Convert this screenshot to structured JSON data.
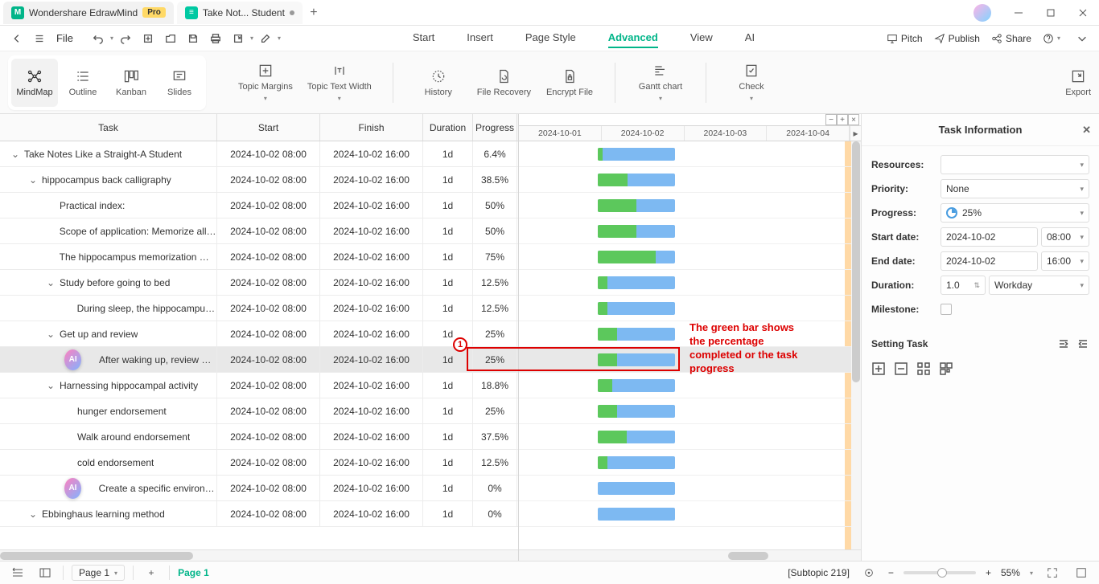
{
  "titlebar": {
    "app_name": "Wondershare EdrawMind",
    "pro_badge": "Pro",
    "doc_tab": "Take Not... Student"
  },
  "quickbar": {
    "file_label": "File"
  },
  "menu": {
    "start": "Start",
    "insert": "Insert",
    "page_style": "Page Style",
    "advanced": "Advanced",
    "view": "View",
    "ai": "AI"
  },
  "right_actions": {
    "pitch": "Pitch",
    "publish": "Publish",
    "share": "Share"
  },
  "view_modes": {
    "mindmap": "MindMap",
    "outline": "Outline",
    "kanban": "Kanban",
    "slides": "Slides"
  },
  "ribbon": {
    "topic_margins": "Topic Margins",
    "topic_text_width": "Topic Text Width",
    "history": "History",
    "file_recovery": "File Recovery",
    "encrypt_file": "Encrypt File",
    "gantt_chart": "Gantt chart",
    "check": "Check",
    "export": "Export"
  },
  "columns": {
    "task": "Task",
    "start": "Start",
    "finish": "Finish",
    "duration": "Duration",
    "progress": "Progress"
  },
  "dates": [
    "2024-10-01",
    "2024-10-02",
    "2024-10-03",
    "2024-10-04"
  ],
  "rows": [
    {
      "indent": 0,
      "exp": true,
      "task": "Take Notes Like a Straight-A Student",
      "start": "2024-10-02 08:00",
      "finish": "2024-10-02 16:00",
      "dur": "1d",
      "prog": "6.4%",
      "pct": 6.4
    },
    {
      "indent": 1,
      "exp": true,
      "task": "hippocampus back calligraphy",
      "start": "2024-10-02 08:00",
      "finish": "2024-10-02 16:00",
      "dur": "1d",
      "prog": "38.5%",
      "pct": 38.5
    },
    {
      "indent": 2,
      "exp": false,
      "task": "Practical index:",
      "start": "2024-10-02 08:00",
      "finish": "2024-10-02 16:00",
      "dur": "1d",
      "prog": "50%",
      "pct": 50
    },
    {
      "indent": 2,
      "exp": false,
      "task": "Scope of application: Memorize all t...",
      "start": "2024-10-02 08:00",
      "finish": "2024-10-02 16:00",
      "dur": "1d",
      "prog": "50%",
      "pct": 50
    },
    {
      "indent": 2,
      "exp": false,
      "task": "The hippocampus memorization me...",
      "start": "2024-10-02 08:00",
      "finish": "2024-10-02 16:00",
      "dur": "1d",
      "prog": "75%",
      "pct": 75
    },
    {
      "indent": 2,
      "exp": true,
      "task": "Study before going to bed",
      "start": "2024-10-02 08:00",
      "finish": "2024-10-02 16:00",
      "dur": "1d",
      "prog": "12.5%",
      "pct": 12.5
    },
    {
      "indent": 3,
      "exp": false,
      "task": "During sleep, the hippocampus ...",
      "start": "2024-10-02 08:00",
      "finish": "2024-10-02 16:00",
      "dur": "1d",
      "prog": "12.5%",
      "pct": 12.5
    },
    {
      "indent": 2,
      "exp": true,
      "task": "Get up and review",
      "start": "2024-10-02 08:00",
      "finish": "2024-10-02 16:00",
      "dur": "1d",
      "prog": "25%",
      "pct": 25
    },
    {
      "indent": 3,
      "exp": false,
      "task": "After waking up, review what yo...",
      "start": "2024-10-02 08:00",
      "finish": "2024-10-02 16:00",
      "dur": "1d",
      "prog": "25%",
      "pct": 25,
      "selected": true,
      "ai": true
    },
    {
      "indent": 2,
      "exp": true,
      "task": "Harnessing hippocampal activity",
      "start": "2024-10-02 08:00",
      "finish": "2024-10-02 16:00",
      "dur": "1d",
      "prog": "18.8%",
      "pct": 18.8
    },
    {
      "indent": 3,
      "exp": false,
      "task": "hunger endorsement",
      "start": "2024-10-02 08:00",
      "finish": "2024-10-02 16:00",
      "dur": "1d",
      "prog": "25%",
      "pct": 25
    },
    {
      "indent": 3,
      "exp": false,
      "task": "Walk around endorsement",
      "start": "2024-10-02 08:00",
      "finish": "2024-10-02 16:00",
      "dur": "1d",
      "prog": "37.5%",
      "pct": 37.5
    },
    {
      "indent": 3,
      "exp": false,
      "task": "cold endorsement",
      "start": "2024-10-02 08:00",
      "finish": "2024-10-02 16:00",
      "dur": "1d",
      "prog": "12.5%",
      "pct": 12.5
    },
    {
      "indent": 3,
      "exp": false,
      "task": "Create a specific environment to...",
      "start": "2024-10-02 08:00",
      "finish": "2024-10-02 16:00",
      "dur": "1d",
      "prog": "0%",
      "pct": 0,
      "ai": true
    },
    {
      "indent": 1,
      "exp": true,
      "task": "Ebbinghaus learning method",
      "start": "2024-10-02 08:00",
      "finish": "2024-10-02 16:00",
      "dur": "1d",
      "prog": "0%",
      "pct": 0
    }
  ],
  "annotation": {
    "marker": "1",
    "text": "The green bar shows the percentage completed or the task progress"
  },
  "panel": {
    "title": "Task Information",
    "resources": "Resources:",
    "priority": "Priority:",
    "priority_val": "None",
    "progress": "Progress:",
    "progress_val": "25%",
    "start_date": "Start date:",
    "start_date_d": "2024-10-02",
    "start_date_t": "08:00",
    "end_date": "End date:",
    "end_date_d": "2024-10-02",
    "end_date_t": "16:00",
    "duration": "Duration:",
    "duration_val": "1.0",
    "duration_unit": "Workday",
    "milestone": "Milestone:",
    "setting_task": "Setting Task"
  },
  "status": {
    "page_sel": "Page 1",
    "page_active": "Page 1",
    "subtopic": "[Subtopic 219]",
    "zoom": "55%"
  }
}
